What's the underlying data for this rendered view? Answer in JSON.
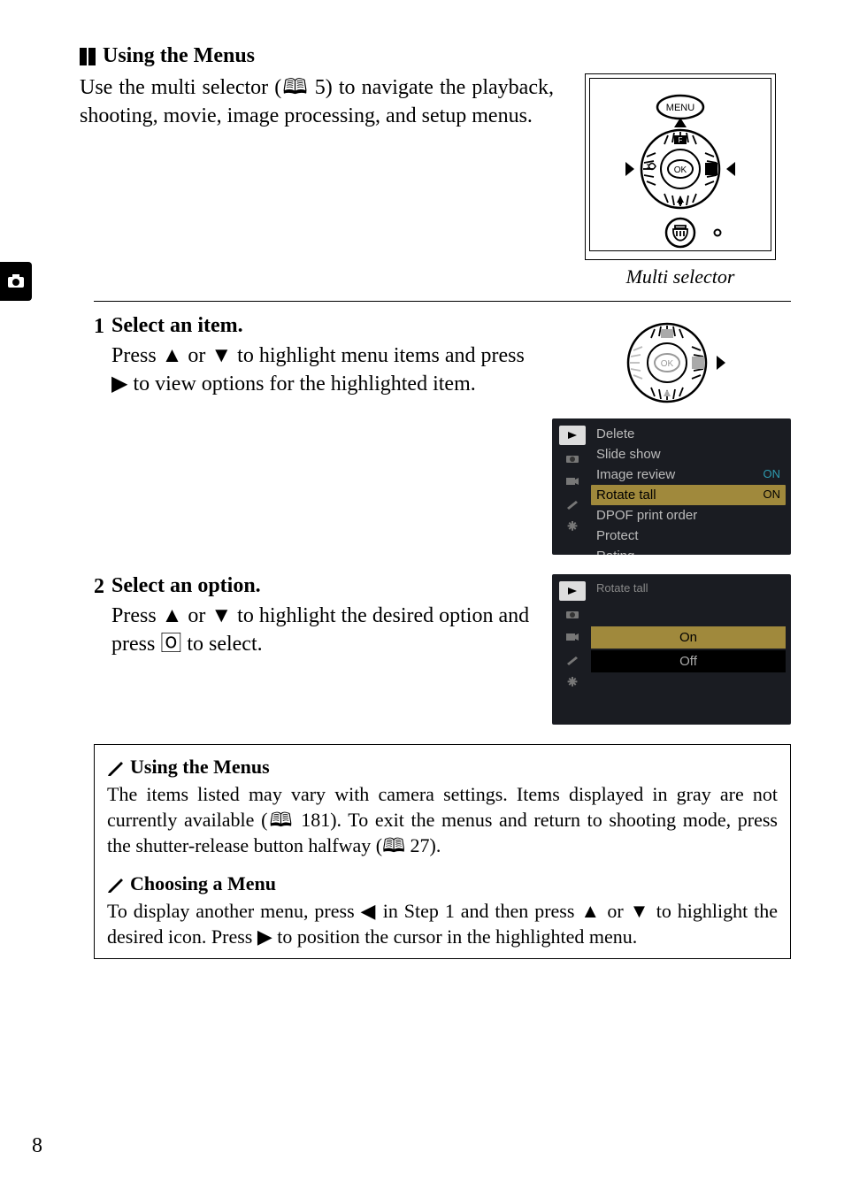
{
  "heading": "Using the Menus",
  "intro": "Use the multi selector (🕮 5) to navigate the playback, shooting, movie, image processing, and setup menus.",
  "multiSelectorCaption": "Multi selector",
  "steps": [
    {
      "num": "1",
      "title": "Select an item.",
      "text": "Press ▲ or ▼ to highlight menu items and press ▶ to view options for the highlighted item."
    },
    {
      "num": "2",
      "title": "Select an option.",
      "text": "Press ▲ or ▼ to highlight the desired option and press 🄾 to select."
    }
  ],
  "menuScreenshot": {
    "items": [
      {
        "label": "Delete",
        "value": ""
      },
      {
        "label": "Slide show",
        "value": ""
      },
      {
        "label": "Image review",
        "value": "ON"
      },
      {
        "label": "Rotate tall",
        "value": "ON",
        "highlighted": true
      },
      {
        "label": "DPOF print order",
        "value": ""
      },
      {
        "label": "Protect",
        "value": ""
      },
      {
        "label": "Rating",
        "value": ""
      }
    ]
  },
  "optionScreenshot": {
    "title": "Rotate tall",
    "options": [
      {
        "label": "On",
        "selected": true
      },
      {
        "label": "Off",
        "selected": false
      }
    ]
  },
  "notes": {
    "title1": "Using the Menus",
    "body1": "The items listed may vary with camera settings. Items displayed in gray are not currently available (🕮 181). To exit the menus and return to shooting mode, press the shutter-release button halfway (🕮 27).",
    "title2": "Choosing a Menu",
    "body2": "To display another menu, press ◀ in Step 1 and then press ▲ or ▼ to highlight the desired icon. Press ▶ to position the cursor in the highlighted menu."
  },
  "pageNumber": "8"
}
